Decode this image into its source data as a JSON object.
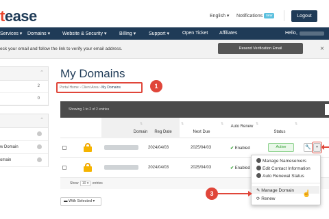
{
  "header": {
    "logo_part1": "t",
    "logo_part2": "ease",
    "language": "English ▾",
    "notifications": "Notifications",
    "notifications_badge": "new",
    "logout": "Logout"
  },
  "nav": {
    "items": [
      "Services ▾",
      "Domains ▾",
      "Website & Security ▾",
      "Billing ▾",
      "Support ▾",
      "Open Ticket",
      "Affiliates"
    ],
    "hello": "Hello,"
  },
  "alert": {
    "message": "eck your email and follow the link to verify your email address.",
    "resend_button": "Resend Verification Email",
    "close": "×"
  },
  "sidebar": {
    "counts": [
      "2",
      "0"
    ],
    "links": [
      "w Domain",
      "omain"
    ]
  },
  "main": {
    "title": "My Domains",
    "breadcrumb": [
      "Portal Home",
      "Client Area",
      "My Domains"
    ],
    "callout_1": "1",
    "callout_3": "3"
  },
  "table": {
    "info": "Showing 1 to 2 of 2 entries",
    "headers": {
      "domain": "Domain",
      "reg_date": "Reg Date",
      "next_due": "Next Due",
      "auto_renew": "Auto Renew",
      "status": "Status"
    },
    "rows": [
      {
        "reg_date": "2024/04/03",
        "next_due": "2025/04/03",
        "auto_renew": "Enabled",
        "status": "Active"
      },
      {
        "reg_date": "2024/04/03",
        "next_due": "2025/04/03",
        "auto_renew": "Enabled"
      }
    ],
    "footer_show": "Show",
    "footer_count": "10 ▾",
    "footer_entries": "entries",
    "with_selected": "With Selected ▾"
  },
  "dropdown": {
    "items": [
      "Manage Nameservers",
      "Edit Contact Information",
      "Auto Renewal Status",
      "Manage Domain",
      "Renew"
    ]
  },
  "colors": {
    "brand_navy": "#1f3b57",
    "brand_red": "#e8452c",
    "annotation_red": "#e0463a",
    "active_green": "#2e9e2e"
  }
}
